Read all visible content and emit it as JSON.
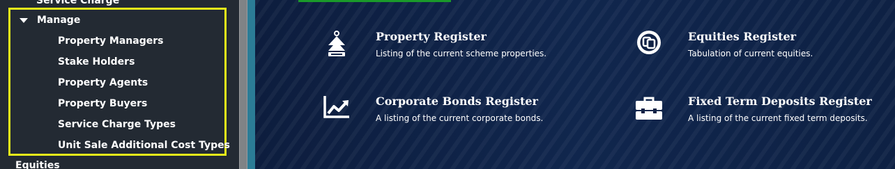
{
  "sidebar": {
    "top_item": "Service Charge",
    "manage": {
      "label": "Manage",
      "items": [
        {
          "label": "Property Managers"
        },
        {
          "label": "Stake Holders"
        },
        {
          "label": "Property Agents"
        },
        {
          "label": "Property Buyers"
        },
        {
          "label": "Service Charge Types"
        },
        {
          "label": "Unit Sale Additional Cost Types"
        }
      ]
    },
    "bottom_item": "Equities"
  },
  "cards": [
    {
      "title": "Property Register",
      "description": "Listing of the current scheme properties.",
      "icon": "property-tree-icon"
    },
    {
      "title": "Equities Register",
      "description": "Tabulation of current equities.",
      "icon": "equities-icon"
    },
    {
      "title": "Corporate Bonds Register",
      "description": "A listing of the current corporate bonds.",
      "icon": "trend-chart-icon"
    },
    {
      "title": "Fixed Term Deposits Register",
      "description": "A listing of the current fixed term deposits.",
      "icon": "toolbox-icon"
    }
  ],
  "colors": {
    "highlight_border": "#e6ef1a",
    "sidebar_bg": "#232a33",
    "main_bg": "#0f2145",
    "accent_strip": "#1a9a2a",
    "divider": "#2b7c96"
  }
}
